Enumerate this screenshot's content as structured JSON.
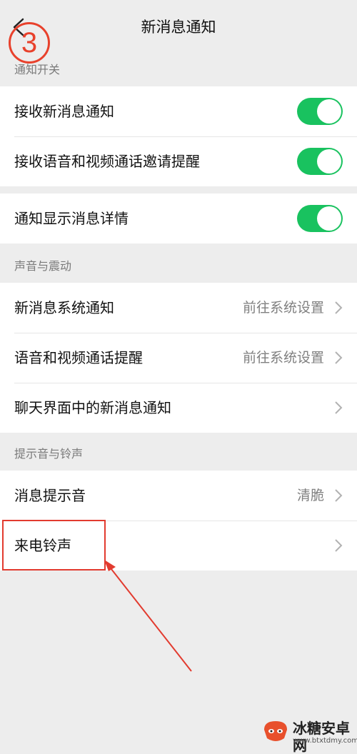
{
  "header": {
    "title": "新消息通知",
    "step_badge": "3"
  },
  "sections": {
    "notify_switch_label": "通知开关",
    "sound_vibration_label": "声音与震动",
    "tone_ringtone_label": "提示音与铃声"
  },
  "switch_group_1": {
    "items": [
      {
        "label": "接收新消息通知",
        "enabled": true
      },
      {
        "label": "接收语音和视频通话邀请提醒",
        "enabled": true
      }
    ]
  },
  "switch_group_2": {
    "items": [
      {
        "label": "通知显示消息详情",
        "enabled": true
      }
    ]
  },
  "sound_group": {
    "items": [
      {
        "label": "新消息系统通知",
        "value": "前往系统设置"
      },
      {
        "label": "语音和视频通话提醒",
        "value": "前往系统设置"
      },
      {
        "label": "聊天界面中的新消息通知",
        "value": ""
      }
    ]
  },
  "tone_group": {
    "items": [
      {
        "label": "消息提示音",
        "value": "清脆"
      },
      {
        "label": "来电铃声",
        "value": ""
      }
    ]
  },
  "watermark": {
    "name": "冰糖安卓网",
    "url": "www.btxtdmy.com"
  },
  "colors": {
    "toggle_on": "#19c25f",
    "annotation_red": "#e23b2f",
    "background": "#ededed"
  }
}
